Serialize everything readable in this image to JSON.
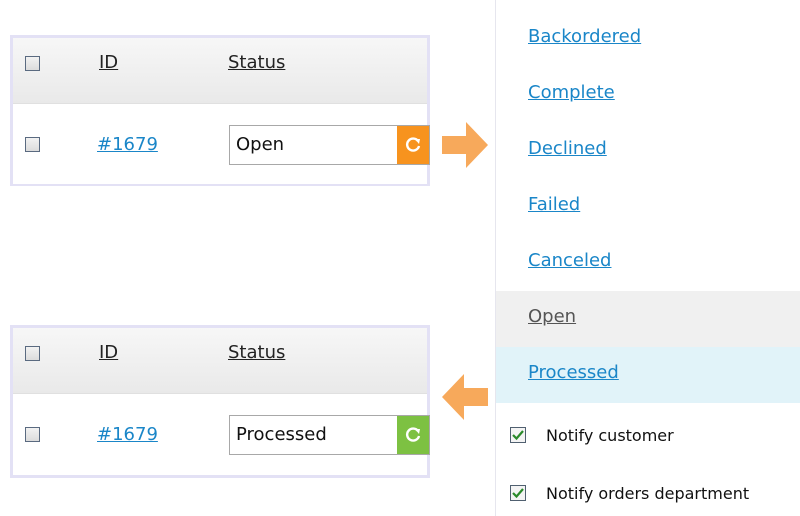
{
  "table": {
    "col_id": "ID",
    "col_status": "Status"
  },
  "before": {
    "order_id": "#1679",
    "status": "Open",
    "button_color": "#f7931e"
  },
  "after": {
    "order_id": "#1679",
    "status": "Processed",
    "button_color": "#7dc142"
  },
  "dropdown": {
    "options": [
      "Backordered",
      "Complete",
      "Declined",
      "Failed",
      "Canceled",
      "Open",
      "Processed"
    ],
    "current": "Open",
    "selected": "Processed",
    "notify_customer": "Notify customer",
    "notify_customer_checked": true,
    "notify_orders": "Notify orders department",
    "notify_orders_checked": true
  },
  "colors": {
    "link": "#1a86c8",
    "arrow": "#f7a95b",
    "panel_border": "#e3e1f5",
    "selected_bg": "#e1f3f9"
  },
  "icons": [
    "refresh-icon",
    "arrow-right-icon",
    "arrow-left-icon",
    "checkmark-icon"
  ]
}
